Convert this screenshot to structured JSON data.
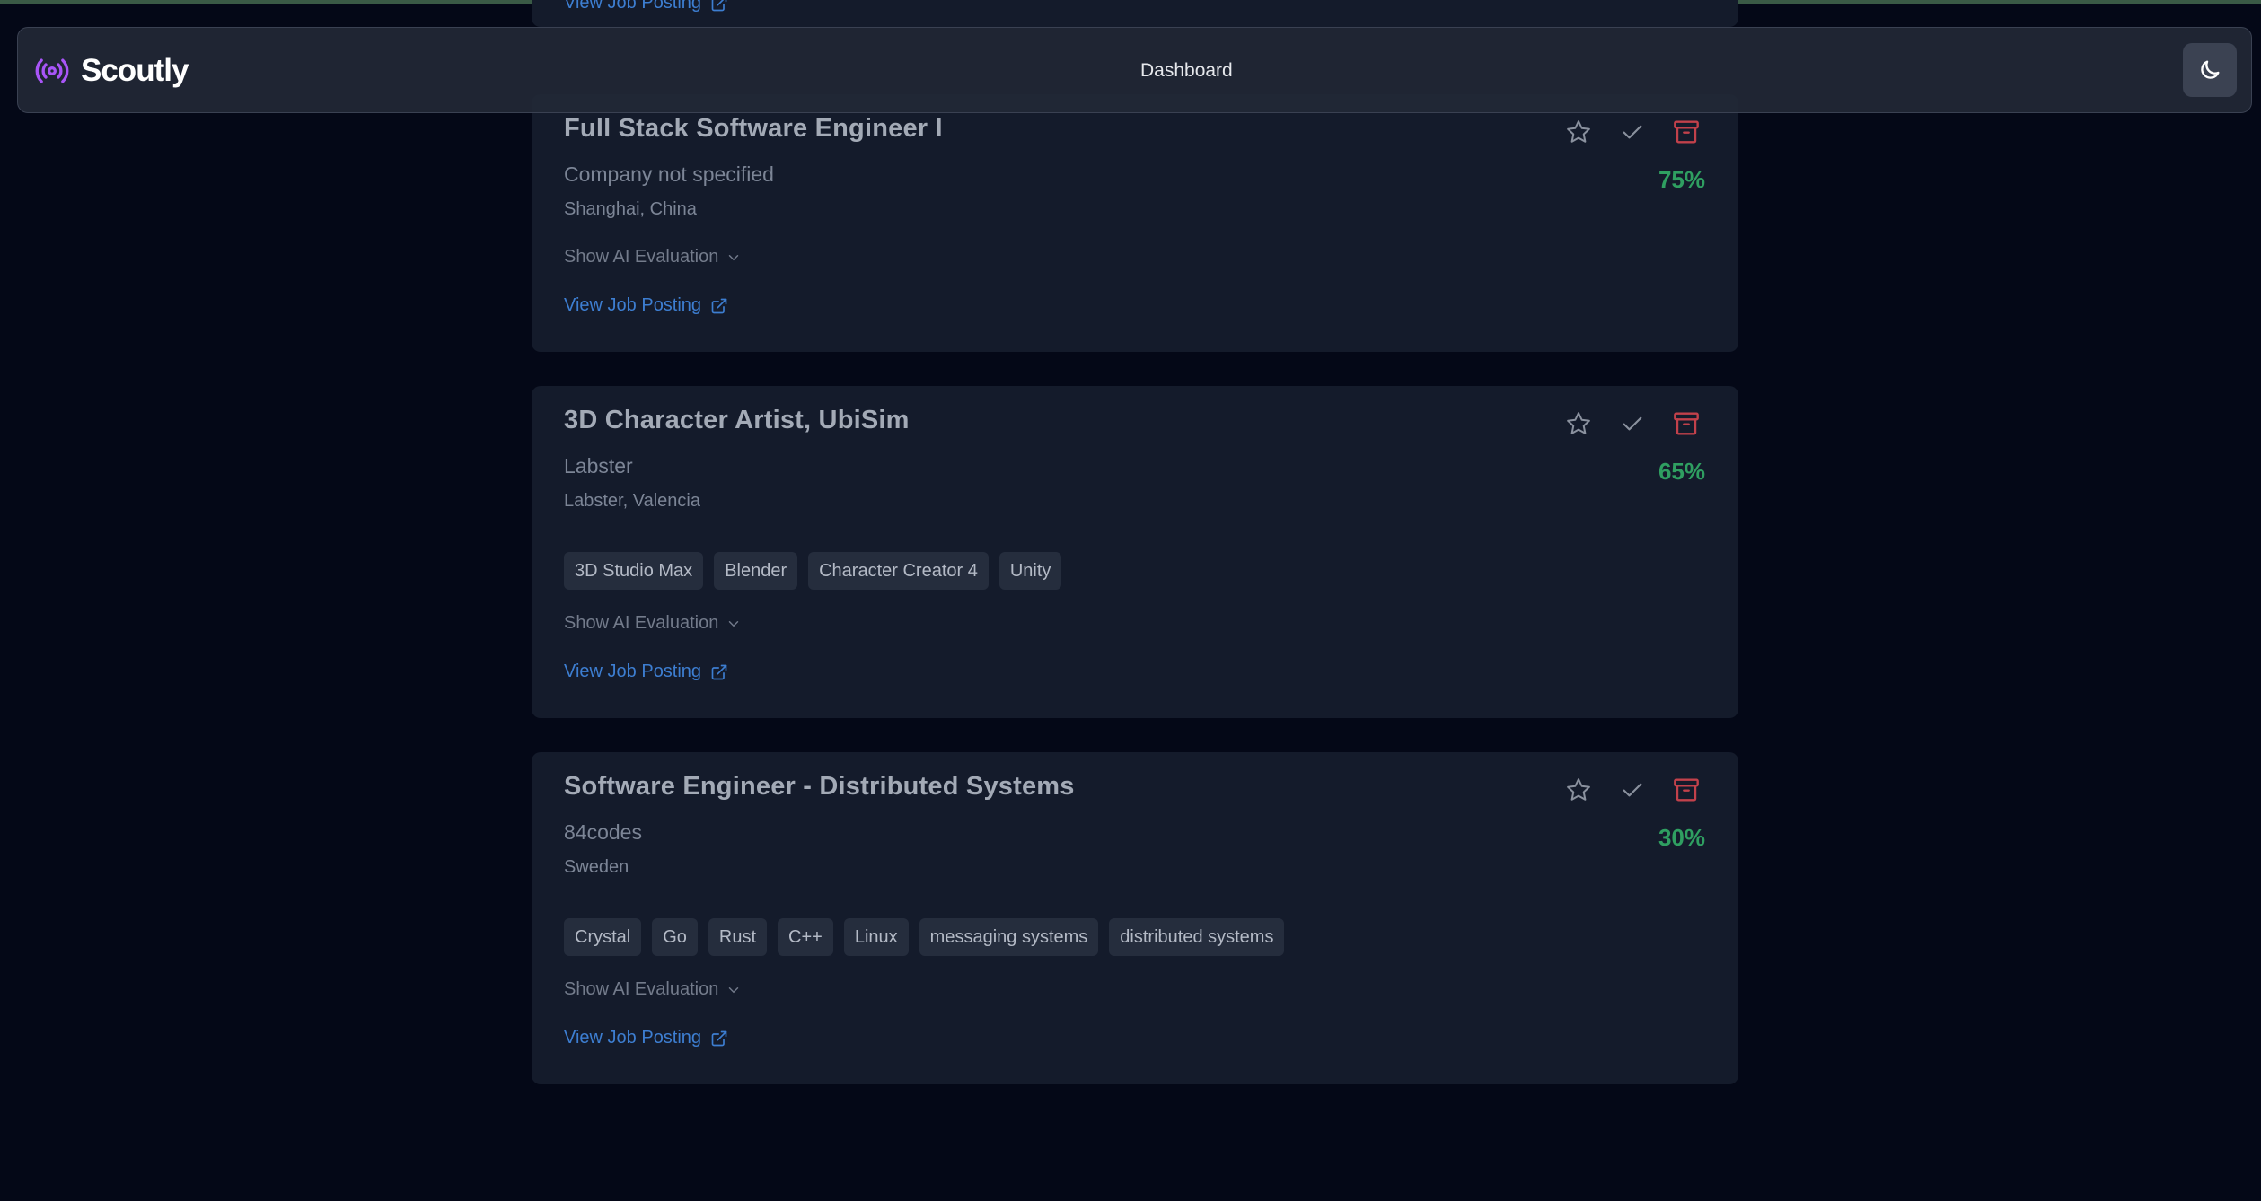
{
  "app": {
    "name": "Scoutly",
    "nav_link": "Dashboard",
    "theme_icon": "moon-icon",
    "logo_icon": "broadcast-icon",
    "accent_color": "#a855f7"
  },
  "partial_card": {
    "link_label": "View Job Posting"
  },
  "jobs": [
    {
      "title": "Full Stack Software Engineer I",
      "company": "Company not specified",
      "location": "Shanghai, China",
      "score": "75%",
      "tags": [],
      "ai_toggle": "Show AI Evaluation",
      "link_label": "View Job Posting"
    },
    {
      "title": "3D Character Artist, UbiSim",
      "company": "Labster",
      "location": "Labster, Valencia",
      "score": "65%",
      "tags": [
        "3D Studio Max",
        "Blender",
        "Character Creator 4",
        "Unity"
      ],
      "ai_toggle": "Show AI Evaluation",
      "link_label": "View Job Posting"
    },
    {
      "title": "Software Engineer - Distributed Systems",
      "company": "84codes",
      "location": "Sweden",
      "score": "30%",
      "tags": [
        "Crystal",
        "Go",
        "Rust",
        "C++",
        "Linux",
        "messaging systems",
        "distributed systems"
      ],
      "ai_toggle": "Show AI Evaluation",
      "link_label": "View Job Posting"
    }
  ],
  "colors": {
    "score": "#2f9f61",
    "link": "#3d7ed1",
    "archive": "#c2414b"
  }
}
